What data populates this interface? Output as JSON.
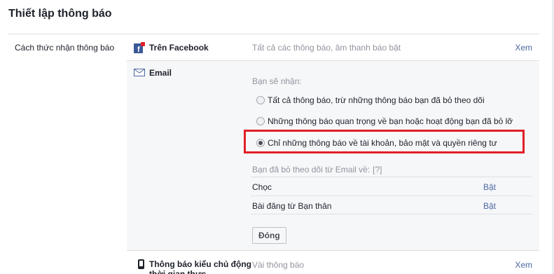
{
  "page": {
    "title": "Thiết lập thông báo"
  },
  "section": {
    "label": "Cách thức nhận thông báo"
  },
  "facebook": {
    "label": "Trên Facebook",
    "description": "Tất cả các thông báo, âm thanh báo bật",
    "view": "Xem",
    "icon": "facebook-notification-icon"
  },
  "email": {
    "label": "Email",
    "icon": "envelope-icon",
    "receive_label": "Bạn sẽ nhận:",
    "options": [
      {
        "label": "Tất cả thông báo, trừ những thông báo bạn đã bỏ theo dõi",
        "checked": false
      },
      {
        "label": "Những thông báo quan trọng về bạn hoặc hoạt động bạn đã bỏ lỡ",
        "checked": false
      },
      {
        "label": "Chỉ những thông báo về tài khoản, bảo mật và quyền riêng tư",
        "checked": true
      }
    ],
    "unsubscribed_label": "Bạn đã bỏ theo dõi từ Email về:",
    "help": "[?]",
    "unsubscribed": [
      {
        "name": "Chọc",
        "action": "Bật"
      },
      {
        "name": "Bài đăng từ Bạn thân",
        "action": "Bật"
      }
    ],
    "close_label": "Đóng",
    "highlight_color": "#e02027"
  },
  "push": {
    "label": "Thông báo kiểu chủ động thời gian thực",
    "description": "Vài thông báo",
    "view": "Xem",
    "icon": "mobile-phone-icon"
  },
  "colors": {
    "link": "#4b67a1",
    "muted": "#90949c",
    "panel": "#f6f7f9"
  }
}
